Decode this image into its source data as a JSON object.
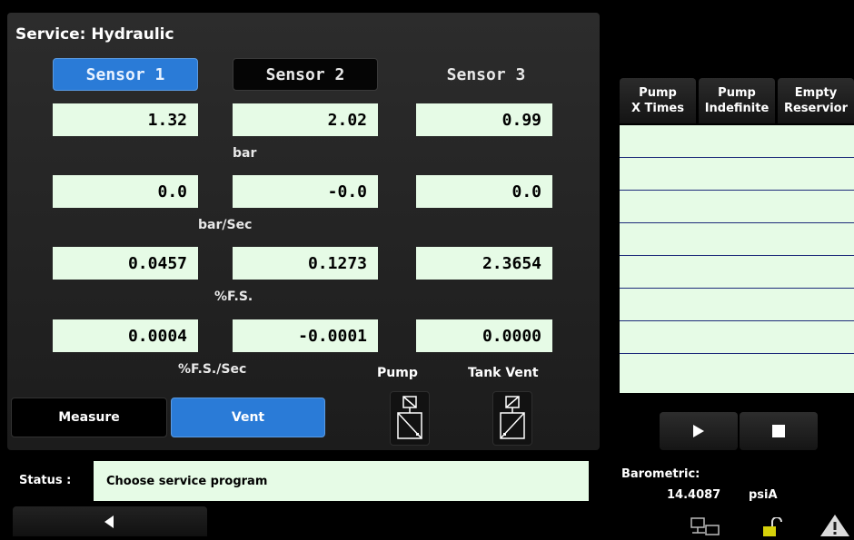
{
  "title": "Service: Hydraulic",
  "sensors": {
    "tabs": [
      "Sensor 1",
      "Sensor 2",
      "Sensor 3"
    ],
    "active_tab": "Sensor 1",
    "rows": [
      {
        "values": [
          "1.32",
          "2.02",
          "0.99"
        ],
        "unit": "bar"
      },
      {
        "values": [
          "0.0",
          "-0.0",
          "0.0"
        ],
        "unit": "bar/Sec"
      },
      {
        "values": [
          "0.0457",
          "0.1273",
          "2.3654"
        ],
        "unit": "%F.S."
      },
      {
        "values": [
          "0.0004",
          "-0.0001",
          "0.0000"
        ],
        "unit": "%F.S./Sec"
      }
    ]
  },
  "valves": {
    "pump_label": "Pump",
    "tank_vent_label": "Tank Vent"
  },
  "mode_buttons": {
    "measure": "Measure",
    "vent": "Vent",
    "active": "Vent"
  },
  "status": {
    "label": "Status :",
    "text": "Choose service program"
  },
  "pump_tabs": [
    {
      "line1": "Pump",
      "line2": "X Times"
    },
    {
      "line1": "Pump",
      "line2": "Indefinite"
    },
    {
      "line1": "Empty",
      "line2": "Reservior"
    }
  ],
  "pump_list_rows": 8,
  "controls": {
    "play_icon": "play-icon",
    "stop_icon": "stop-icon"
  },
  "barometric": {
    "label": "Barometric:",
    "value": "14.4087",
    "unit": "psiA"
  },
  "icons": {
    "network": "network-icon",
    "lock": "unlock-icon",
    "warning": "warning-icon",
    "back": "back-arrow-icon"
  },
  "colors": {
    "accent_blue": "#2a7bd7",
    "field_green": "#e6fbe6",
    "warning_gray": "#dcdcdc"
  }
}
